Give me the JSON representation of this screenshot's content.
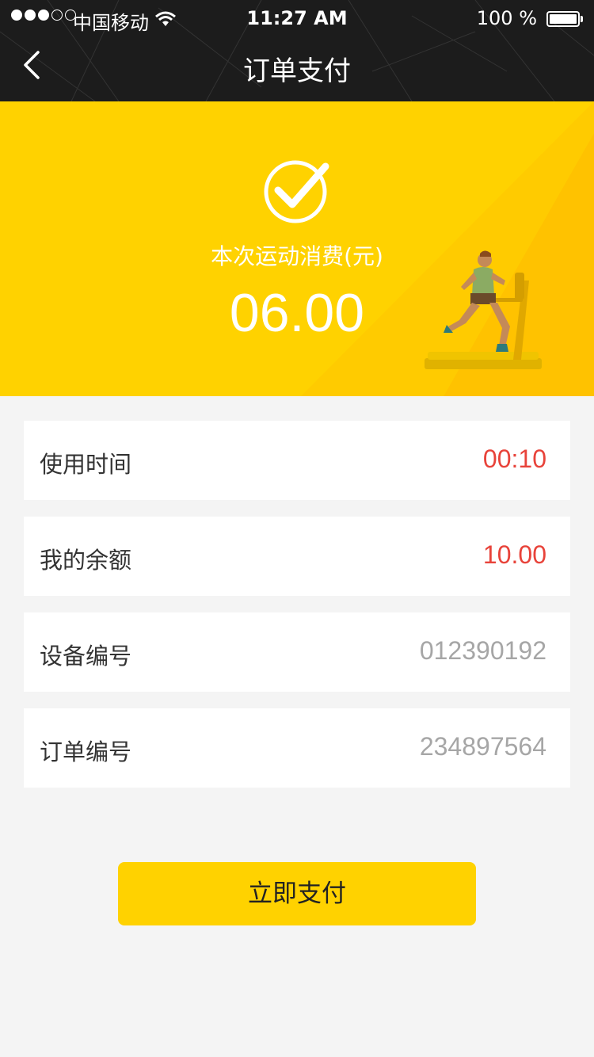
{
  "status_bar": {
    "carrier": "中国移动",
    "time": "11:27 AM",
    "battery_percent": "100 %",
    "signal_bars": 3,
    "signal_total": 5
  },
  "nav": {
    "back_icon": "chevron-left-icon",
    "title": "订单支付"
  },
  "banner": {
    "icon": "checkmark-circle-icon",
    "caption": "本次运动消费(元)",
    "amount": "06.00",
    "illustration": "runner-treadmill-illustration"
  },
  "rows": [
    {
      "label": "使用时间",
      "value": "00:10",
      "tone": "red"
    },
    {
      "label": "我的余额",
      "value": "10.00",
      "tone": "red"
    },
    {
      "label": "设备编号",
      "value": "012390192",
      "tone": "gray"
    },
    {
      "label": "订单编号",
      "value": "234897564",
      "tone": "gray"
    }
  ],
  "pay_button": {
    "label": "立即支付"
  },
  "colors": {
    "header_bg": "#1c1c1c",
    "accent_yellow": "#ffd200",
    "value_red": "#e8433a",
    "value_gray": "#a6a6a6",
    "page_bg": "#f4f4f4"
  }
}
